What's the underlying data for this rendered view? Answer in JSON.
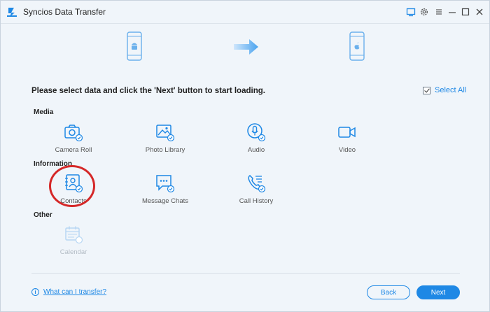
{
  "window": {
    "title": "Syncios Data Transfer"
  },
  "toolbar_icons": [
    "screen-icon",
    "settings-icon",
    "menu-icon",
    "minimize-icon",
    "maximize-icon",
    "close-icon"
  ],
  "devices": {
    "source": "android-phone-icon",
    "target": "apple-phone-icon"
  },
  "instruction": "Please select data and click the 'Next' button to start loading.",
  "select_all": {
    "label": "Select All",
    "checked": true
  },
  "sections": [
    {
      "label": "Media",
      "items": [
        {
          "label": "Camera Roll",
          "icon": "camera-icon",
          "checked": true
        },
        {
          "label": "Photo Library",
          "icon": "photo-icon",
          "checked": true
        },
        {
          "label": "Audio",
          "icon": "audio-icon",
          "checked": true
        },
        {
          "label": "Video",
          "icon": "video-icon",
          "checked": true
        }
      ]
    },
    {
      "label": "Information",
      "items": [
        {
          "label": "Contacts",
          "icon": "contacts-icon",
          "checked": true
        },
        {
          "label": "Message Chats",
          "icon": "message-icon",
          "checked": true
        },
        {
          "label": "Call History",
          "icon": "call-history-icon",
          "checked": true
        }
      ]
    },
    {
      "label": "Other",
      "items": [
        {
          "label": "Calendar",
          "icon": "calendar-icon",
          "checked": false,
          "disabled": true
        }
      ]
    }
  ],
  "footer": {
    "help_link": "What can I transfer?",
    "back_label": "Back",
    "next_label": "Next"
  },
  "colors": {
    "accent": "#1e88e5",
    "background": "#f0f5fa",
    "highlight_circle": "#d52828",
    "disabled": "#b3bcc5"
  }
}
